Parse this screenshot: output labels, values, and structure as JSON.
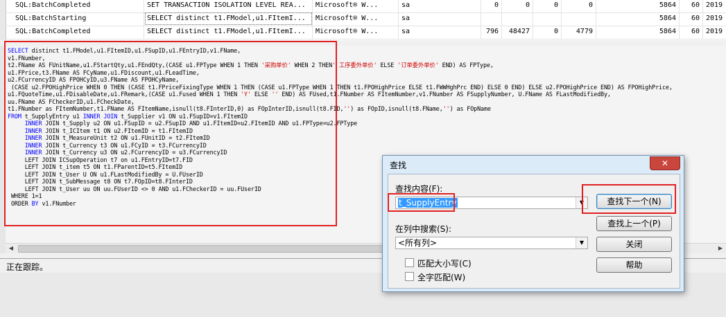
{
  "trace_grid": {
    "rows": [
      {
        "event": "SQL:BatchCompleted",
        "text": "SET TRANSACTION ISOLATION LEVEL REA...",
        "app": "Microsoft® W...",
        "login": "sa",
        "cpu": "0",
        "reads": "0",
        "writes": "0",
        "duration": "0",
        "spid": "5864",
        "col2": "60",
        "start": "2019"
      },
      {
        "event": "SQL:BatchStarting",
        "text": "SELECT distinct t1.FModel,u1.FItemI...",
        "app": "Microsoft® W...",
        "login": "sa",
        "cpu": "",
        "reads": "",
        "writes": "",
        "duration": "",
        "spid": "5864",
        "col2": "60",
        "start": "2019"
      },
      {
        "event": "SQL:BatchCompleted",
        "text": "SELECT distinct t1.FModel,u1.FItemI...",
        "app": "Microsoft® W...",
        "login": "sa",
        "cpu": "796",
        "reads": "48427",
        "writes": "0",
        "duration": "4779",
        "spid": "5864",
        "col2": "60",
        "start": "2019"
      }
    ]
  },
  "sql_lines": [
    [
      {
        "k": 1,
        "t": "SELECT"
      },
      {
        "t": " distinct t1.FModel,u1.FItemID,u1.FSupID,u1.FEntryID,v1.FName,"
      }
    ],
    [
      {
        "t": "v1.FNumber,"
      }
    ],
    [
      {
        "t": "t2.FName AS FUnitName,u1.FStartQty,u1.FEndQty,(CASE u1.FPType WHEN 1 THEN "
      },
      {
        "s": 1,
        "t": "'采购单价'"
      },
      {
        "t": " WHEN 2 THEN"
      },
      {
        "s": 1,
        "t": "' 工序委外单价'"
      },
      {
        "t": " ELSE "
      },
      {
        "s": 1,
        "t": "'订单委外单价'"
      },
      {
        "t": " END) AS FPType,"
      }
    ],
    [
      {
        "t": "u1.FPrice,t3.FName AS FCyName,u1.FDiscount,u1.FLeadTime,"
      }
    ],
    [
      {
        "t": "u2.FCurrencyID AS FPOHCyID,u3.FName AS FPOHCyName,"
      }
    ],
    [
      {
        "t": " (CASE u2.FPOHighPrice WHEN 0 THEN (CASE t1.FPriceFixingType WHEN 1 THEN (CASE u1.FPType WHEN 1 THEN t1.FPOHighPrice ELSE t1.FWWHghPrc END) ELSE 0 END) ELSE u2.FPOHighPrice END) AS FPOHighPrice,"
      }
    ],
    [
      {
        "t": "u1.FQuoteTime,u1.FDisableDate,u1.FRemark,(CASE u1.Fused WHEN 1 THEN "
      },
      {
        "s": 1,
        "t": "'Y'"
      },
      {
        "t": " ELSE "
      },
      {
        "s": 1,
        "t": "''"
      },
      {
        "t": " END) AS FUsed,t1.FNumber AS FItemNumber,v1.FNumber AS FSupplyNumber, U.FName AS FLastModifiedBy,"
      }
    ],
    [
      {
        "t": "uu.FName AS FCheckerID,u1.FCheckDate,"
      }
    ],
    [
      {
        "t": "t1.FNumber as FItemNumber,t1.FName AS FItemName,isnull(t8.FInterID,0) as FOpInterID,isnull(t8.FID,"
      },
      {
        "s": 1,
        "t": "''"
      },
      {
        "t": ") as FOpID,isnull(t8.FName,"
      },
      {
        "s": 1,
        "t": "''"
      },
      {
        "t": ") as FOpName"
      }
    ],
    [
      {
        "k": 1,
        "t": "FROM"
      },
      {
        "t": " t_SupplyEntry u1 "
      },
      {
        "k": 1,
        "t": "INNER JOIN"
      },
      {
        "t": " t_Supplier v1 ON u1.FSupID=v1.FItemID"
      }
    ],
    [
      {
        "t": "     "
      },
      {
        "k": 1,
        "t": "INNER"
      },
      {
        "t": " JOIN t_Supply u2 ON u1.FSupID = u2.FSupID AND u1.FItemID=u2.FItemID AND u1.FPType=u2.FPType"
      }
    ],
    [
      {
        "t": "     "
      },
      {
        "k": 1,
        "t": "INNER"
      },
      {
        "t": " JOIN t_ICItem t1 ON u2.FItemID = t1.FItemID"
      }
    ],
    [
      {
        "t": "     "
      },
      {
        "k": 1,
        "t": "INNER"
      },
      {
        "t": " JOIN t_MeasureUnit t2 ON u1.FUnitID = t2.FItemID"
      }
    ],
    [
      {
        "t": "     "
      },
      {
        "k": 1,
        "t": "INNER"
      },
      {
        "t": " JOIN t_Currency t3 ON u1.FCyID = t3.FCurrencyID"
      }
    ],
    [
      {
        "t": "     "
      },
      {
        "k": 1,
        "t": "INNER"
      },
      {
        "t": " JOIN t_Currency u3 ON u2.FCurrencyID = u3.FCurrencyID"
      }
    ],
    [
      {
        "t": "     LEFT JOIN ICSupOperation t7 on u1.FEntryID=t7.FID"
      }
    ],
    [
      {
        "t": "     LEFT JOIN t_item t5 ON t1.FParentID=t5.FItemID"
      }
    ],
    [
      {
        "t": "     LEFT JOIN t_User U ON u1.FLastModifiedBy = U.FUserID"
      }
    ],
    [
      {
        "t": "     LEFT JOIN t_SubMessage t8 ON t7.FOpID=t8.FInterID"
      }
    ],
    [
      {
        "t": "     LEFT JOIN t_User uu ON uu.FUserID <> 0 AND u1.FCheckerID = uu.FUserID"
      }
    ],
    [
      {
        "t": " WHERE 1=1"
      }
    ],
    [
      {
        "t": " ORDER "
      },
      {
        "k": 1,
        "t": "BY"
      },
      {
        "t": " v1.FNumber"
      }
    ]
  ],
  "status_text": "正在跟踪。",
  "find_dialog": {
    "title": "查找",
    "close_glyph": "✕",
    "find_what_label": "查找内容(F):",
    "find_what_value": "t_SupplyEntry",
    "search_in_label": "在列中搜索(S):",
    "search_in_value": "<所有列>",
    "find_next": "查找下一个(N)",
    "find_prev": "查找上一个(P)",
    "close": "关闭",
    "help": "帮助",
    "match_case": "匹配大小写(C)",
    "whole_word": "全字匹配(W)"
  },
  "colors": {
    "keyword": "#0000ff",
    "string": "#d00000",
    "annotation": "#e02020",
    "selection": "#3399ff"
  }
}
